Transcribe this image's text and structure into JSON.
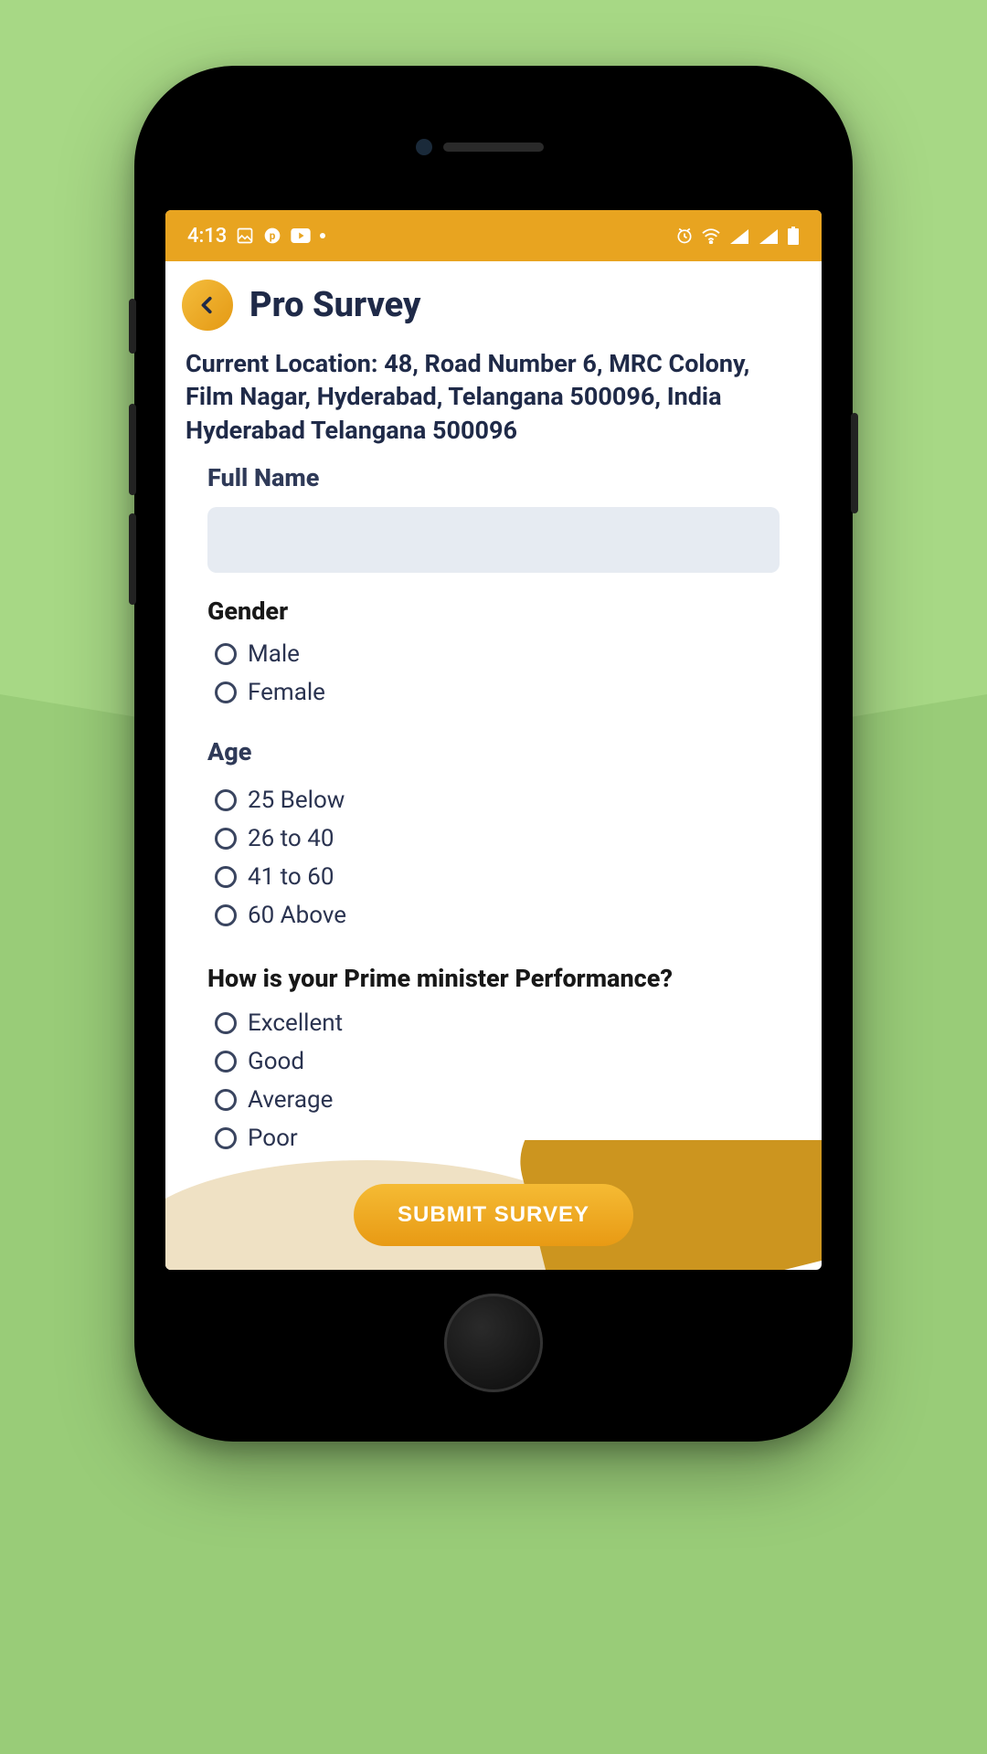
{
  "status": {
    "time": "4:13",
    "icons_left": [
      "image-icon",
      "app-p-icon",
      "youtube-icon",
      "dot-icon"
    ],
    "icons_right": [
      "alarm-icon",
      "wifi-icon",
      "call-signal-1-icon",
      "call-signal-2-icon",
      "battery-icon"
    ]
  },
  "header": {
    "title": "Pro Survey"
  },
  "location_text": "Current Location: 48, Road Number 6, MRC Colony, Film Nagar, Hyderabad, Telangana 500096, India Hyderabad Telangana 500096",
  "form": {
    "full_name_label": "Full Name",
    "full_name_value": "",
    "gender": {
      "label": "Gender",
      "options": [
        "Male",
        "Female"
      ]
    },
    "age": {
      "label": "Age",
      "options": [
        "25 Below",
        "26 to 40",
        "41 to 60",
        "60 Above"
      ]
    },
    "pm": {
      "label": "How is your Prime minister Performance?",
      "options": [
        "Excellent",
        "Good",
        "Average",
        "Poor"
      ]
    },
    "submit_label": "SUBMIT SURVEY"
  }
}
